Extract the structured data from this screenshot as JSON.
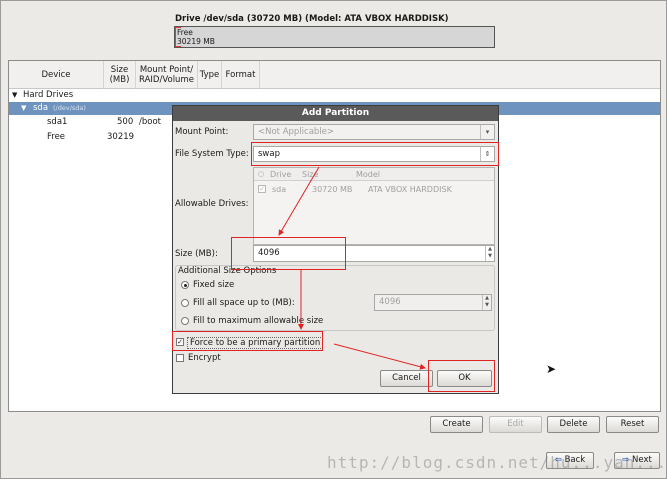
{
  "drive": {
    "title": "Drive /dev/sda (30720 MB) (Model: ATA VBOX HARDDISK)",
    "seg_name": "Free",
    "seg_size": "30219 MB"
  },
  "tree": {
    "columns": [
      "Device",
      "Size\n(MB)",
      "Mount Point/\nRAID/Volume",
      "Type",
      "Format"
    ],
    "hard_drives": "Hard Drives",
    "sda": "sda",
    "sda_path": "(/dev/sda)",
    "rows": [
      {
        "device": "sda1",
        "size": "500",
        "mount": "/boot"
      },
      {
        "device": "Free",
        "size": "30219",
        "mount": ""
      }
    ]
  },
  "dialog": {
    "title": "Add Partition",
    "mount_label": "Mount Point:",
    "mount_value": "<Not Applicable>",
    "fstype_label": "File System Type:",
    "fstype_value": "swap",
    "drives_label": "Allowable Drives:",
    "drives_head": [
      "Drive",
      "Size",
      "Model"
    ],
    "drives_row": {
      "drive": "sda",
      "size": "30720 MB",
      "model": "ATA VBOX HARDDISK"
    },
    "size_label": "Size (MB):",
    "size_value": "4096",
    "options_title": "Additional Size Options",
    "opt_fixed": "Fixed size",
    "opt_fill_upto": "Fill all space up to (MB):",
    "opt_fill_upto_value": "4096",
    "opt_fill_max": "Fill to maximum allowable size",
    "primary_label": "Force to be a primary partition",
    "encrypt_label": "Encrypt",
    "cancel": "Cancel",
    "ok": "OK"
  },
  "actions": {
    "create": "Create",
    "edit": "Edit",
    "delete": "Delete",
    "reset": "Reset"
  },
  "nav": {
    "back": "Back",
    "next": "Next"
  },
  "watermark": "http://blog.csdn.net/hu...yan...",
  "colors": {
    "selection": "#6e93be",
    "annotation": "#e02424",
    "dialog_title_bg": "#5a5a5a"
  }
}
